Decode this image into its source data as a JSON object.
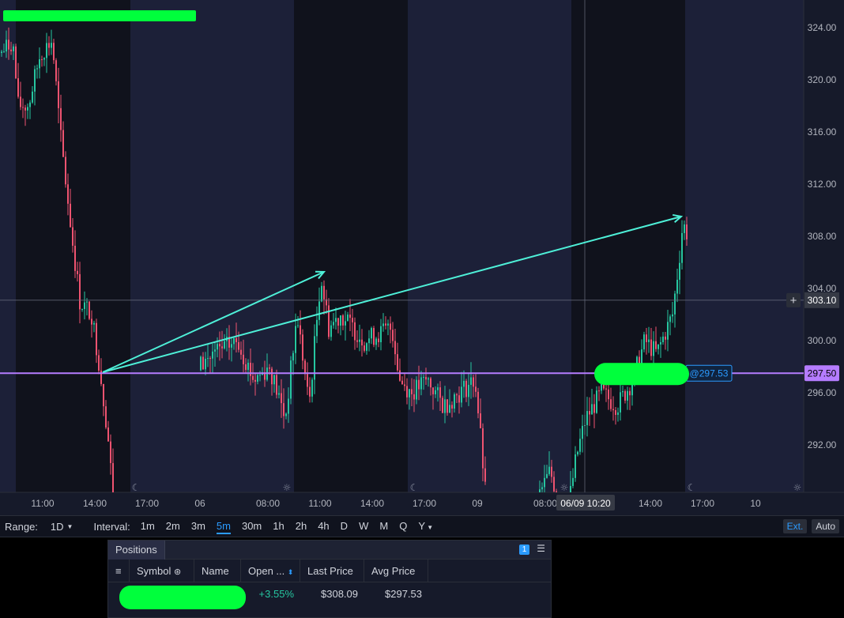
{
  "chart": {
    "price_axis_labels": [
      "324.00",
      "320.00",
      "316.00",
      "312.00",
      "308.00",
      "304.00",
      "300.00",
      "296.00",
      "292.00"
    ],
    "crosshair_price": "303.10",
    "avg_price_line_label": "297.50",
    "avg_price_tag": "@297.53",
    "time_axis_labels": [
      "11:00",
      "14:00",
      "17:00",
      "06",
      "08:00",
      "11:00",
      "14:00",
      "17:00",
      "09",
      "08:00",
      "14:00",
      "17:00",
      "10"
    ],
    "crosshair_time": "06/09 10:20",
    "colors": {
      "background": "#161a2a",
      "after_hours_shade": "#1c2038",
      "session_shade": "#10121c",
      "up_candle": "#26c6a0",
      "down_candle": "#ef5370",
      "trend_arrow": "#4ef0d8",
      "avg_price_line": "#b57cff",
      "redaction": "#00ff3c"
    },
    "icons": [
      "moon-icon",
      "sun-icon",
      "plus-icon"
    ]
  },
  "toolbar": {
    "range_label": "Range:",
    "range_value": "1D",
    "interval_label": "Interval:",
    "intervals": [
      "1m",
      "2m",
      "3m",
      "5m",
      "30m",
      "1h",
      "2h",
      "4h",
      "D",
      "W",
      "M",
      "Q",
      "Y"
    ],
    "active_interval": "5m",
    "ext_label": "Ext.",
    "auto_label": "Auto"
  },
  "positions": {
    "tab_label": "Positions",
    "count_badge": "1",
    "columns": [
      "Symbol",
      "Name",
      "Open ...",
      "Last Price",
      "Avg Price"
    ],
    "row": {
      "open_pct": "+3.55%",
      "last_price": "$308.09",
      "avg_price": "$297.53"
    }
  }
}
